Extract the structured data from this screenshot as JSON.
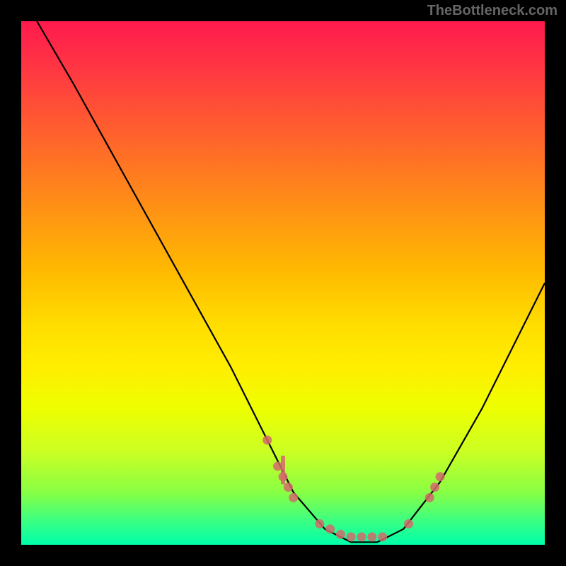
{
  "watermark": "TheBottleneck.com",
  "chart_data": {
    "type": "line",
    "title": "",
    "xlabel": "",
    "ylabel": "",
    "xlim": [
      0,
      100
    ],
    "ylim": [
      0,
      100
    ],
    "curve": [
      {
        "x": 3,
        "y": 100
      },
      {
        "x": 10,
        "y": 88
      },
      {
        "x": 20,
        "y": 70
      },
      {
        "x": 30,
        "y": 52
      },
      {
        "x": 40,
        "y": 34
      },
      {
        "x": 47,
        "y": 20
      },
      {
        "x": 52,
        "y": 10
      },
      {
        "x": 58,
        "y": 3
      },
      {
        "x": 63,
        "y": 0.5
      },
      {
        "x": 68,
        "y": 0.5
      },
      {
        "x": 73,
        "y": 3
      },
      {
        "x": 80,
        "y": 12
      },
      {
        "x": 88,
        "y": 26
      },
      {
        "x": 95,
        "y": 40
      },
      {
        "x": 100,
        "y": 50
      }
    ],
    "points": [
      {
        "x": 47,
        "y": 20
      },
      {
        "x": 49,
        "y": 15
      },
      {
        "x": 50,
        "y": 13
      },
      {
        "x": 51,
        "y": 11
      },
      {
        "x": 52,
        "y": 9
      },
      {
        "x": 57,
        "y": 4
      },
      {
        "x": 59,
        "y": 3
      },
      {
        "x": 61,
        "y": 2
      },
      {
        "x": 63,
        "y": 1.5
      },
      {
        "x": 65,
        "y": 1.5
      },
      {
        "x": 67,
        "y": 1.5
      },
      {
        "x": 69,
        "y": 1.5
      },
      {
        "x": 74,
        "y": 4
      },
      {
        "x": 78,
        "y": 9
      },
      {
        "x": 79,
        "y": 11
      },
      {
        "x": 80,
        "y": 13
      }
    ],
    "bars": [
      {
        "x": 50,
        "h": 3
      }
    ]
  }
}
